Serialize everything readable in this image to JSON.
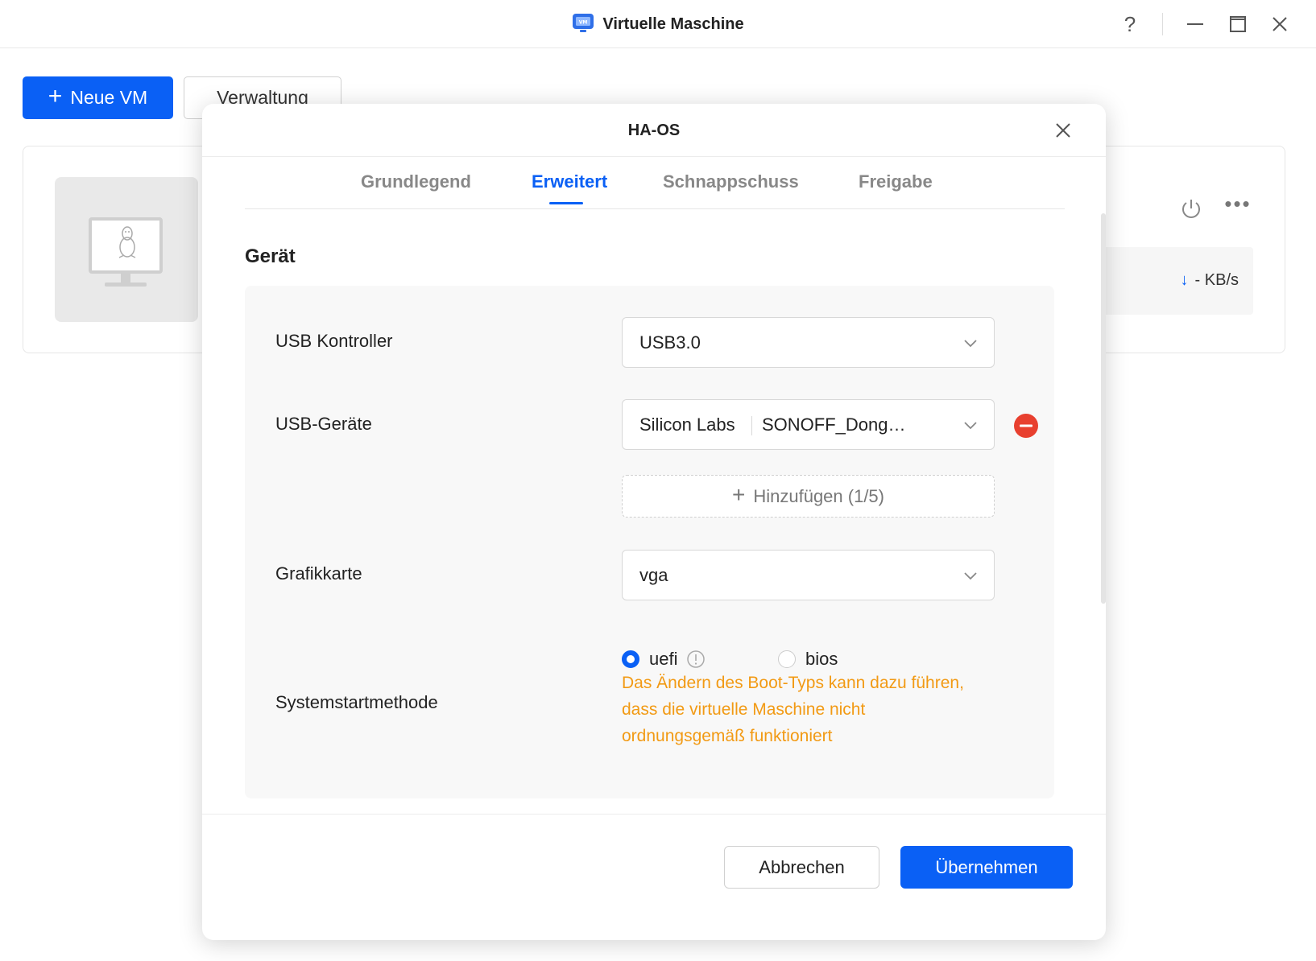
{
  "window": {
    "title": "Virtuelle Maschine",
    "help_label": "?"
  },
  "toolbar": {
    "new_vm_label": "Neue VM",
    "manage_label": "Verwaltung"
  },
  "vm_card": {
    "net_speed": "- KB/s"
  },
  "modal": {
    "title": "HA-OS",
    "tabs": [
      {
        "label": "Grundlegend",
        "active": false
      },
      {
        "label": "Erweitert",
        "active": true
      },
      {
        "label": "Schnappschuss",
        "active": false
      },
      {
        "label": "Freigabe",
        "active": false
      }
    ],
    "section_title": "Gerät",
    "usb_controller": {
      "label": "USB Kontroller",
      "value": "USB3.0"
    },
    "usb_devices": {
      "label": "USB-Geräte",
      "vendor": "Silicon Labs",
      "device": "SONOFF_Dong…",
      "add_label": "Hinzufügen (1/5)"
    },
    "graphics": {
      "label": "Grafikkarte",
      "value": "vga"
    },
    "boot": {
      "label": "Systemstartmethode",
      "options": [
        {
          "label": "uefi",
          "selected": true
        },
        {
          "label": "bios",
          "selected": false
        }
      ],
      "warning": "Das Ändern des Boot-Typs kann dazu führen, dass die virtuelle Maschine nicht ordnungsgemäß funktioniert"
    },
    "cancel_label": "Abbrechen",
    "apply_label": "Übernehmen"
  },
  "colors": {
    "accent": "#0a60f5",
    "warning": "#f29a14",
    "danger": "#e8402f"
  }
}
